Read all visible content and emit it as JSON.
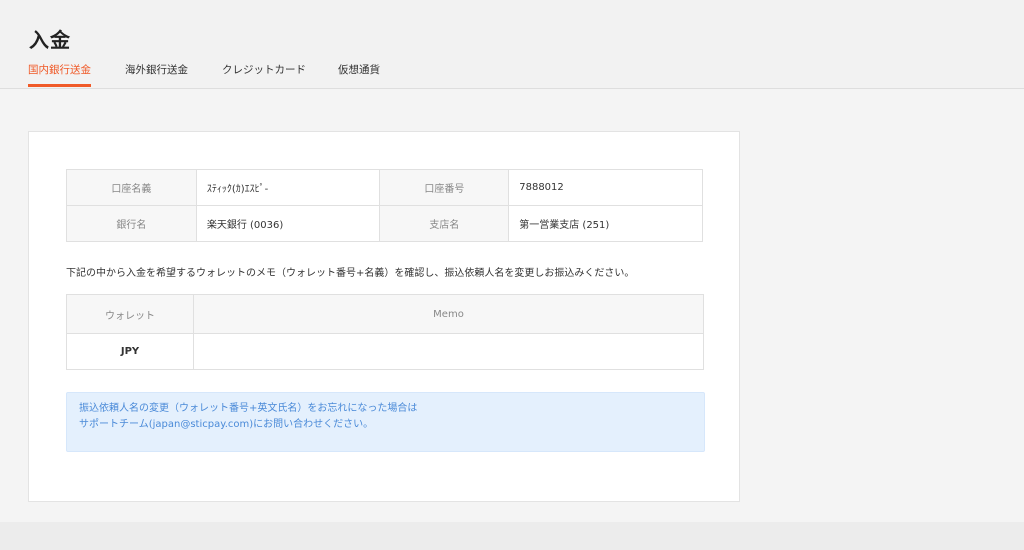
{
  "header": {
    "title": "入金",
    "tabs": [
      {
        "label": "国内銀行送金",
        "active": true
      },
      {
        "label": "海外銀行送金",
        "active": false
      },
      {
        "label": "クレジットカード",
        "active": false
      },
      {
        "label": "仮想通貨",
        "active": false
      }
    ]
  },
  "bank": {
    "account_name_label": "口座名義",
    "account_name_value": "ｽﾃｨｯｸ(ｶ)ｴｽﾋﾟ-",
    "account_number_label": "口座番号",
    "account_number_value": "7888012",
    "bank_name_label": "銀行名",
    "bank_name_value": "楽天銀行 (0036)",
    "branch_label": "支店名",
    "branch_value": "第一営業支店 (251)"
  },
  "instruction": "下記の中から入金を希望するウォレットのメモ（ウォレット番号+名義）を確認し、振込依頼人名を変更しお振込みください。",
  "wallet_table": {
    "headers": [
      "ウォレット",
      "Memo"
    ],
    "rows": [
      {
        "wallet": "JPY",
        "memo": ""
      }
    ]
  },
  "notice": {
    "line1": "振込依頼人名の変更（ウォレット番号+英文氏名）をお忘れになった場合は",
    "line2": "サポートチーム(japan@sticpay.com)にお問い合わせください。"
  },
  "colors": {
    "accent": "#f05a28",
    "notice_bg": "#e4f0fd",
    "notice_text": "#4a8ad8"
  }
}
